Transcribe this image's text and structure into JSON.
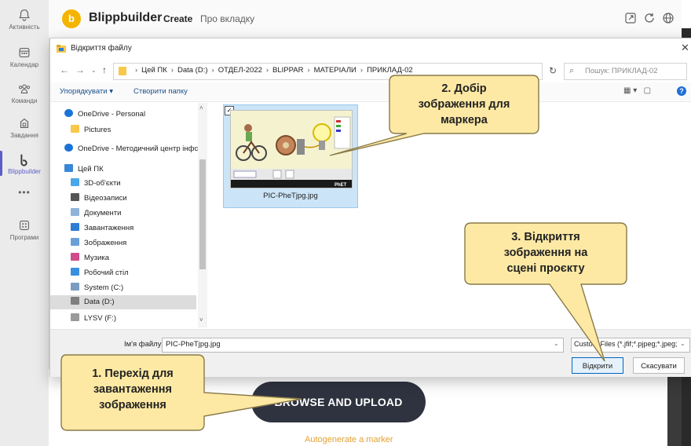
{
  "teams_rail": {
    "items": [
      {
        "label": "Активність",
        "icon": "bell-icon"
      },
      {
        "label": "Календар",
        "icon": "calendar-icon"
      },
      {
        "label": "Команди",
        "icon": "teams-icon"
      },
      {
        "label": "Завдання",
        "icon": "assignments-icon"
      },
      {
        "label": "Blippbuilder",
        "icon": "blippbuilder-icon"
      },
      {
        "label": "Програми",
        "icon": "apps-icon"
      }
    ],
    "more": "•••"
  },
  "app": {
    "logo_letter": "b",
    "name": "Blippbuilder",
    "tabs": [
      "Create",
      "Про вкладку"
    ]
  },
  "dialog": {
    "title": "Відкриття файлу",
    "breadcrumbs": [
      "Цей ПК",
      "Data (D:)",
      "ОТДЕЛ-2022",
      "BLIPPAR",
      "МАТЕРІАЛИ",
      "ПРИКЛАД-02"
    ],
    "search_placeholder": "Пошук: ПРИКЛАД-02",
    "toolbar": {
      "organize": "Упорядкувати ▾",
      "new_folder": "Створити папку"
    },
    "nav_items": [
      {
        "label": "OneDrive - Personal",
        "icon": "cloud-icon",
        "color": "#1a73d9"
      },
      {
        "label": "Pictures",
        "icon": "folder-icon",
        "color": "#f8c84a"
      },
      {
        "label": "OneDrive - Методичний центр інфс",
        "icon": "cloud-icon",
        "color": "#1a73d9"
      },
      {
        "label": "Цей ПК",
        "icon": "computer-icon",
        "color": "#3a87d6"
      },
      {
        "label": "3D-об'єкти",
        "icon": "3d-objects-icon",
        "color": "#4aa8e8"
      },
      {
        "label": "Відеозаписи",
        "icon": "videos-icon",
        "color": "#555555"
      },
      {
        "label": "Документи",
        "icon": "documents-icon",
        "color": "#8fb3d9"
      },
      {
        "label": "Завантаження",
        "icon": "downloads-icon",
        "color": "#2d7cd6"
      },
      {
        "label": "Зображення",
        "icon": "pictures-icon",
        "color": "#6aa0d8"
      },
      {
        "label": "Музика",
        "icon": "music-icon",
        "color": "#d04b8a"
      },
      {
        "label": "Робочий стіл",
        "icon": "desktop-icon",
        "color": "#3b8fe0"
      },
      {
        "label": "System (C:)",
        "icon": "drive-icon",
        "color": "#7a9cc0"
      },
      {
        "label": "Data (D:)",
        "icon": "drive-icon",
        "color": "#7f7f7f",
        "selected": true
      },
      {
        "label": "LYSV (F:)",
        "icon": "drive-icon",
        "color": "#9a9a9a"
      }
    ],
    "file": {
      "name": "PIC-PheTjpg.jpg",
      "checked": true,
      "thumb_caption": "PhET"
    },
    "file_name_label": "Ім'я файлу:",
    "file_name_value": "PIC-PheTjpg.jpg",
    "filter_value": "Custom Files (*.jfif;*.pjpeg;*.jpeg;",
    "open_button": "Відкрити",
    "cancel_button": "Скасувати"
  },
  "background": {
    "browse_button": "BROWSE AND UPLOAD",
    "autogenerate_link": "Autogenerate a marker"
  },
  "callouts": [
    {
      "text": "1. Перехід для\nзавантаження\nзображення"
    },
    {
      "text": "2. Добір\nзображення для\nмаркера"
    },
    {
      "text": "3. Відкриття\nзображення на\nсцені проєкту"
    }
  ],
  "colors": {
    "callout_fill": "#fde9a4",
    "callout_stroke": "#8a7a4a",
    "teams_accent": "#5b5fc7",
    "brand_yellow": "#f4b400"
  }
}
